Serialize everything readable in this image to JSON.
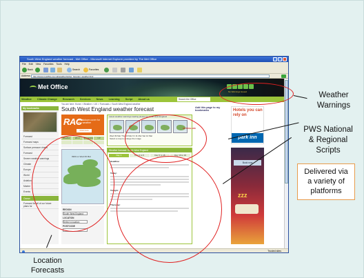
{
  "browser": {
    "title": "South West England weather forecast - Met Office - Microsoft Internet Explorer provided by The Met Office",
    "menu": "File Edit View Favorites Tools Help",
    "toolbar_back": "Back",
    "toolbar_search": "Search",
    "toolbar_favorites": "Favorites",
    "address_label": "Address",
    "address_url": "http://www.metoffice.gov.uk/weather/uk/sw_forecast_weather.html",
    "status_zone": "Trusted sites"
  },
  "site": {
    "logo": "Met Office",
    "nav": [
      "Weather",
      "Climate Change",
      "Research",
      "Services",
      "News",
      "Learning",
      "Script",
      "About us"
    ],
    "search_placeholder": "Search the Office",
    "breadcrumb": "You are here: Home > Weather > UK > Forecasts > South West England weather",
    "page_title": "South West England weather forecast",
    "warnings_caption": "No Warnings Issued",
    "left_header": "My bookmarks",
    "left_items": [
      "Forecast",
      "Forecast maps",
      "Surface pressure charts",
      "Forecast",
      "Severe weather warnings",
      "Climate",
      "Europe",
      "World",
      "Aviation",
      "Marine",
      "Events",
      "Ocean",
      "Forecast for all of our future plans for"
    ],
    "rac_brand": "RAC",
    "rac_text": "Breakdown cover for any weather",
    "rac_button": "Click here",
    "forecast_tabs": [
      "Weather",
      "Wind",
      "Temperature",
      "UV"
    ],
    "map_caption": "0900 on Wed 09 Mar",
    "region_title": "REGION",
    "region_select": "South West England",
    "location_title": "LOCATION",
    "location_select": "Select a location",
    "postcode_title": "POSTCODE",
    "obs_header": "Latest weather warnings loading please for south west England",
    "obs_dates": "Wed 09 Mar  Thu 10 Mar  Fri 11 Mar  Sat 12 Mar",
    "obs_cta": "Select a map to enlarge the image",
    "autoglass": "AUTOGLASS",
    "fcst_header": "Weather forecast: South West England",
    "fcst_tabs": [
      "Day 1",
      "Day 2 to 5",
      "Day 6 to 15",
      "Day 16 to 30"
    ],
    "fcst_headline": "Headline:",
    "fcst_today": "Today:",
    "fcst_tonight": "Tonight:",
    "fcst_thursday": "Thursday:",
    "bookmark_link": "Add this page to my bookmarks",
    "ad_hotels": "Hotels you can rely on",
    "ad_brand": "park inn",
    "ad_book": "Book now",
    "ad_zzz": "zzz"
  },
  "callouts": {
    "warnings": [
      "Weather",
      "Warnings"
    ],
    "pws": [
      "PWS National",
      "& Regional",
      "Scripts"
    ],
    "delivered": [
      "Delivered via",
      "a variety of",
      "platforms"
    ],
    "location": [
      "Location",
      "Forecasts"
    ]
  },
  "colors": {
    "slide_bg": "#e3f1f0",
    "met_green": "#9cc43a",
    "annotation_red": "#e02020",
    "rac_orange": "#e56b17",
    "parkinn_blue": "#0067b1"
  }
}
